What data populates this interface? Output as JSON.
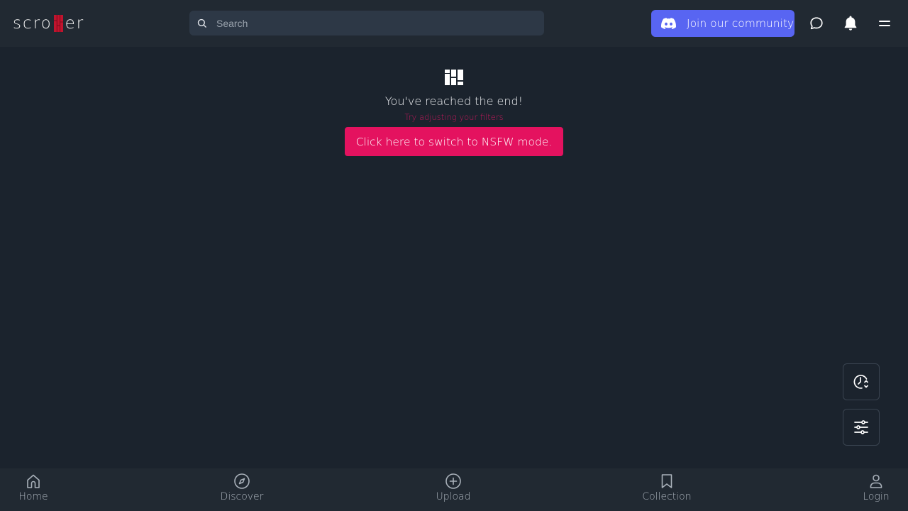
{
  "header": {
    "logo_text_left": "scro",
    "logo_text_right": "er",
    "search_placeholder": "Search",
    "search_value": "",
    "community_button_label": "Join our community"
  },
  "main": {
    "end_title": "You've reached the end!",
    "end_subtitle": "Try adjusting your filters",
    "nsfw_button_label": "Click here to switch to NSFW mode."
  },
  "bottom_nav": {
    "items": [
      {
        "label": "Home",
        "icon": "home-icon"
      },
      {
        "label": "Discover",
        "icon": "compass-icon"
      },
      {
        "label": "Upload",
        "icon": "plus-circle-icon"
      },
      {
        "label": "Collection",
        "icon": "bookmark-icon"
      },
      {
        "label": "Login",
        "icon": "user-icon"
      }
    ]
  },
  "icons": {
    "header": [
      "search-icon",
      "discord-icon",
      "chat-bubble-icon",
      "bell-icon",
      "menu-icon"
    ],
    "floating": [
      "clock-sort-icon",
      "sliders-icon"
    ],
    "end_of_feed": "columns-icon"
  },
  "colors": {
    "background": "#1b232d",
    "bar": "#212932",
    "search_bg": "#2d3846",
    "discord": "#5865f2",
    "nsfw_button": "#e4125f",
    "subtitle": "#c2185b",
    "logo_mark": "#c0142e"
  }
}
